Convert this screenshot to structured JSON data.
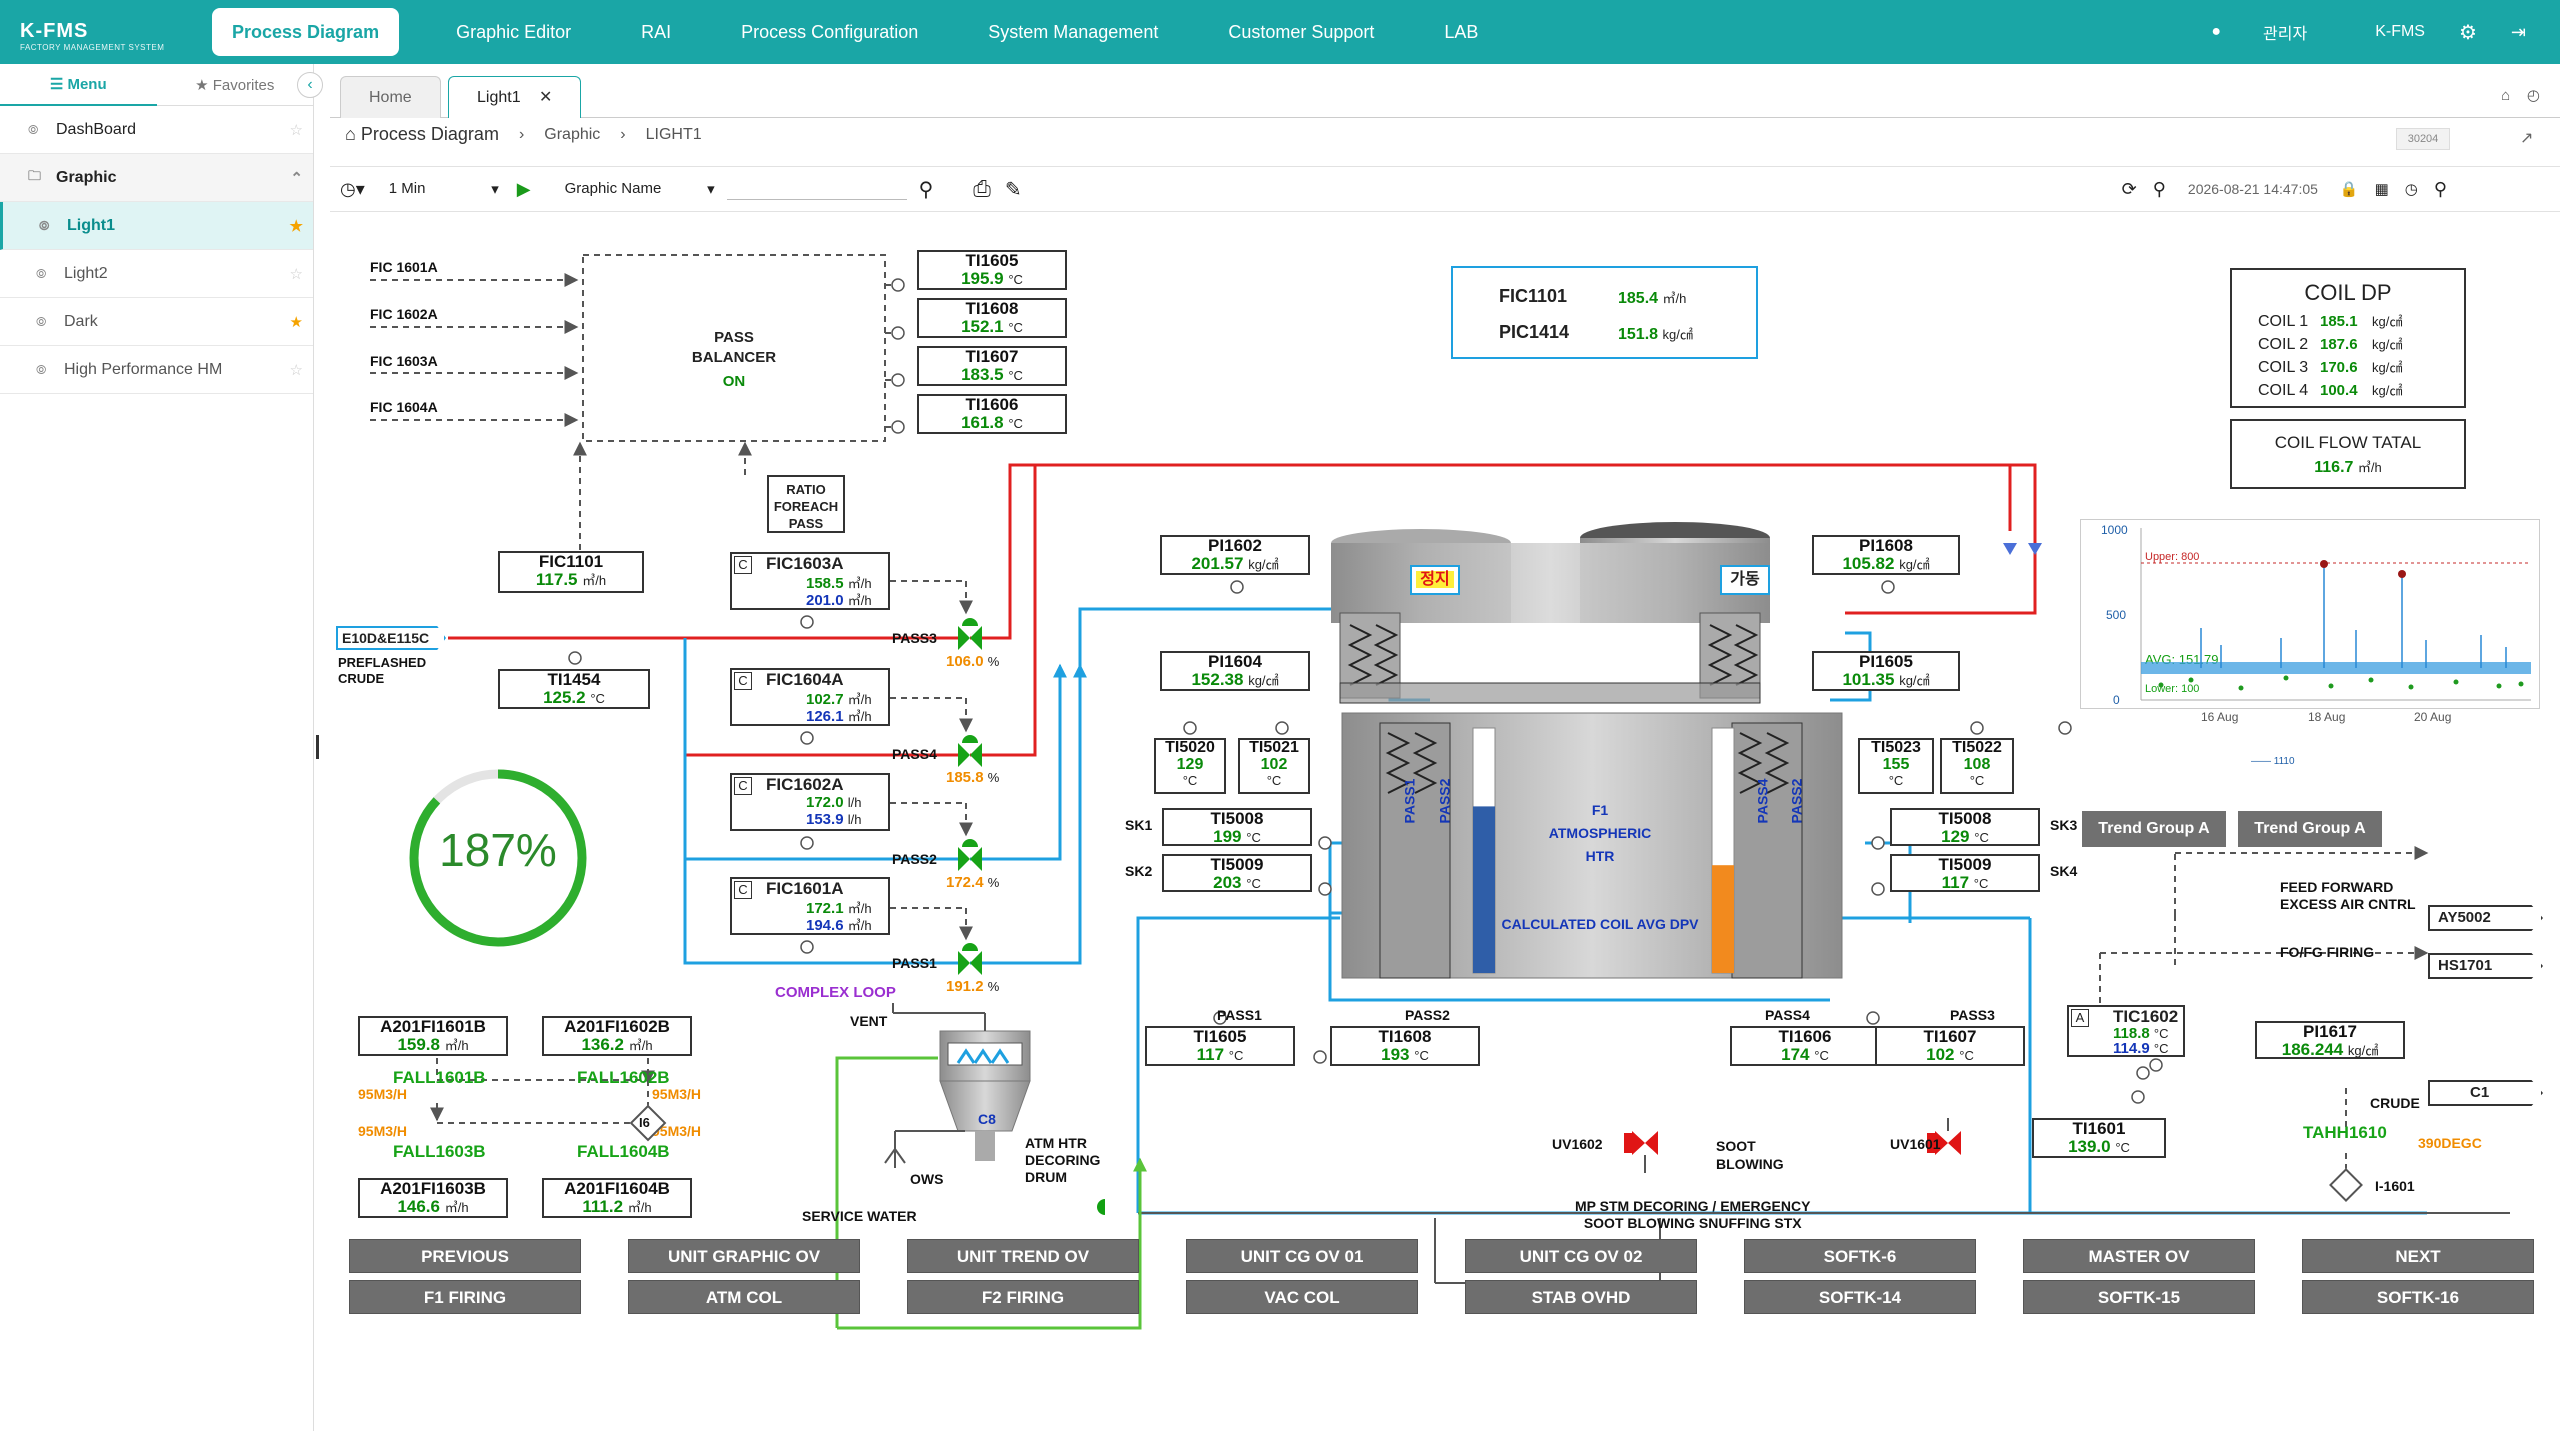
{
  "app": {
    "logo": "K-FMS",
    "logo_sub": "FACTORY MANAGEMENT SYSTEM"
  },
  "menu": [
    "Process Diagram",
    "Graphic Editor",
    "RAI",
    "Process Configuration",
    "System Management",
    "Customer Support",
    "LAB"
  ],
  "user": {
    "name": "관리자",
    "site": "K-FMS"
  },
  "sidebar": {
    "tab_menu": "Menu",
    "tab_favorites": "Favorites",
    "items": [
      {
        "label": "DashBoard",
        "star": false
      },
      {
        "label": "Graphic",
        "group": true
      },
      {
        "label": "Light1",
        "star": true,
        "selected": true
      },
      {
        "label": "Light2",
        "star": false
      },
      {
        "label": "Dark",
        "star": true
      },
      {
        "label": "High Performance HM",
        "star": false
      }
    ]
  },
  "tabs": {
    "home": "Home",
    "active": "Light1"
  },
  "breadcrumb": {
    "root": "Process Diagram",
    "mid": "Graphic",
    "leaf": "LIGHT1",
    "code": "30204"
  },
  "toolbar": {
    "interval": "1 Min",
    "graphic_name": "Graphic Name",
    "timestamp": "2026-08-21 14:47:05"
  },
  "diagram": {
    "fic_inputs": [
      "FIC 1601A",
      "FIC 1602A",
      "FIC 1603A",
      "FIC 1604A"
    ],
    "pass_balancer": {
      "l1": "PASS",
      "l2": "BALANCER",
      "state": "ON"
    },
    "ratio_box": [
      "RATIO",
      "FOREACH",
      "PASS"
    ],
    "ti_top": [
      {
        "tag": "TI1605",
        "val": "195.9",
        "unit": "°C"
      },
      {
        "tag": "TI1608",
        "val": "152.1",
        "unit": "°C"
      },
      {
        "tag": "TI1607",
        "val": "183.5",
        "unit": "°C"
      },
      {
        "tag": "TI1606",
        "val": "161.8",
        "unit": "°C"
      }
    ],
    "fic1101_left": {
      "tag": "FIC1101",
      "val": "117.5",
      "unit": "㎥/h"
    },
    "ti1454": {
      "tag": "TI1454",
      "val": "125.2",
      "unit": "°C"
    },
    "feed": {
      "tag": "E10D&E115C",
      "l1": "PRELASHED",
      "l2": "CRUDE"
    },
    "feed_l1": "PREFLASHED",
    "gauge_value": "187%",
    "gauge_fraction": 0.87,
    "fic_pass": [
      {
        "tag": "FIC1603A",
        "v1": "158.5",
        "v2": "201.0",
        "unit": "㎥/h",
        "pass": "PASS3",
        "pct": "106.0",
        "c": "C"
      },
      {
        "tag": "FIC1604A",
        "v1": "102.7",
        "v2": "126.1",
        "unit": "㎥/h",
        "pass": "PASS4",
        "pct": "185.8",
        "c": "C"
      },
      {
        "tag": "FIC1602A",
        "v1": "172.0",
        "v2": "153.9",
        "unit": "l/h",
        "pass": "PASS2",
        "pct": "172.4",
        "c": "C"
      },
      {
        "tag": "FIC1601A",
        "v1": "172.1",
        "v2": "194.6",
        "unit": "㎥/h",
        "pass": "PASS1",
        "pct": "191.2",
        "c": "C"
      }
    ],
    "pct_unit": "%",
    "complex_loop": "COMPLEX LOOP",
    "fic_summary": [
      {
        "tag": "FIC1101",
        "val": "185.4",
        "unit": "㎥/h"
      },
      {
        "tag": "PIC1414",
        "val": "151.8",
        "unit": "kg/㎠"
      }
    ],
    "coil_dp": {
      "title": "COIL DP",
      "rows": [
        {
          "tag": "COIL 1",
          "val": "185.1",
          "unit": "kg/㎠"
        },
        {
          "tag": "COIL 2",
          "val": "187.6",
          "unit": "kg/㎠"
        },
        {
          "tag": "COIL 3",
          "val": "170.6",
          "unit": "kg/㎠"
        },
        {
          "tag": "COIL 4",
          "val": "100.4",
          "unit": "kg/㎠"
        }
      ]
    },
    "coil_flow": {
      "title": "COIL FLOW TATAL",
      "val": "116.7",
      "unit": "㎥/h"
    },
    "pi_left": [
      {
        "tag": "PI1602",
        "val": "201.57",
        "unit": "kg/㎠"
      },
      {
        "tag": "PI1604",
        "val": "152.38",
        "unit": "kg/㎠"
      }
    ],
    "pi_right": [
      {
        "tag": "PI1608",
        "val": "105.82",
        "unit": "kg/㎠"
      },
      {
        "tag": "PI1605",
        "val": "101.35",
        "unit": "kg/㎠"
      }
    ],
    "stop_label": "정지",
    "run_label": "가동",
    "ti_small_left": [
      {
        "tag": "TI5020",
        "val": "129",
        "unit": "°C"
      },
      {
        "tag": "TI5021",
        "val": "102",
        "unit": "°C"
      }
    ],
    "ti_small_right": [
      {
        "tag": "TI5023",
        "val": "155",
        "unit": "°C"
      },
      {
        "tag": "TI5022",
        "val": "108",
        "unit": "°C"
      }
    ],
    "sk_left": [
      {
        "sk": "SK1",
        "tag": "TI5008",
        "val": "199",
        "unit": "°C"
      },
      {
        "sk": "SK2",
        "tag": "TI5009",
        "val": "203",
        "unit": "°C"
      }
    ],
    "sk_right": [
      {
        "sk": "SK3",
        "tag": "TI5008",
        "val": "129",
        "unit": "°C"
      },
      {
        "sk": "SK4",
        "tag": "TI5009",
        "val": "117",
        "unit": "°C"
      }
    ],
    "furnace": {
      "l1": "F1",
      "l2": "ATMOSPHERIC",
      "l3": "HTR",
      "l4": "CALCULATED COIL AVG DPV",
      "level_left": 0.68,
      "level_right": 0.44
    },
    "pass_labels": [
      "PASS1",
      "PASS2",
      "PASS4",
      "PASS2"
    ],
    "ti_bottom": [
      {
        "pass": "PASS1",
        "tag": "TI1605",
        "val": "117",
        "unit": "°C"
      },
      {
        "pass": "PASS2",
        "tag": "TI1608",
        "val": "193",
        "unit": "°C"
      },
      {
        "pass": "PASS4",
        "tag": "TI1606",
        "val": "174",
        "unit": "°C"
      },
      {
        "pass": "PASS3",
        "tag": "TI1607",
        "val": "102",
        "unit": "°C"
      }
    ],
    "tic1602": {
      "c": "A",
      "tag": "TIC1602",
      "v1": "118.8",
      "v2": "114.9",
      "unit": "°C"
    },
    "pi1617": {
      "tag": "PI1617",
      "val": "186.244",
      "unit": "kg/㎠"
    },
    "ti1601": {
      "tag": "TI1601",
      "val": "139.0",
      "unit": "°C"
    },
    "right_tags": [
      {
        "label": "FEED FORWARD",
        "label2": "EXCESS AIR CNTRL",
        "tag": "AY5002"
      },
      {
        "label": "FO/FG FIRING",
        "tag": "HS1701"
      },
      {
        "label": "CRUDE",
        "tag": "C1"
      }
    ],
    "tahh": {
      "tag": "TAHH1610",
      "val": "390DEGC"
    },
    "i1601": "I-1601",
    "uv": [
      "UV1602",
      "UV1601"
    ],
    "soot": {
      "l1": "SOOT",
      "l2": "BLOWING",
      "l3": "MP STM DECORING / EMERGENCY",
      "l4": "SOOT BLOWING SNUFFING STX"
    },
    "vent": "VENT",
    "c8": {
      "tag": "C8",
      "l1": "ATM HTR",
      "l2": "DECORING",
      "l3": "DRUM"
    },
    "ows": "OWS",
    "service_water": "SERVICE WATER",
    "fall_boxes": [
      {
        "tag": "A201FI1601B",
        "val": "159.8",
        "unit": "㎥/h",
        "fall": "FALL1601B",
        "rate": "95M3/H"
      },
      {
        "tag": "A201FI1602B",
        "val": "136.2",
        "unit": "㎥/h",
        "fall": "FALL1602B",
        "rate": "95M3/H"
      },
      {
        "tag": "A201FI1603B",
        "val": "146.6",
        "unit": "㎥/h",
        "fall": "FALL1603B",
        "rate": "95M3/H"
      },
      {
        "tag": "A201FI1604B",
        "val": "111.2",
        "unit": "㎥/h",
        "fall": "FALL1604B",
        "rate": "95M3/H"
      }
    ],
    "i16": "I6"
  },
  "trend": {
    "ymax": "1000",
    "ymid": "500",
    "ymin": "0",
    "upper_label": "Upper: 800",
    "avg_label": "AVG: 151.79",
    "lower_label": "Lower: 100",
    "x_labels": [
      "16 Aug",
      "18 Aug",
      "20 Aug"
    ],
    "legend": "1110",
    "buttons": [
      "Trend Group A",
      "Trend Group A"
    ]
  },
  "bottom_buttons": [
    [
      "PREVIOUS",
      "UNIT GRAPHIC OV",
      "UNIT TREND OV",
      "UNIT CG OV 01",
      "UNIT CG OV 02",
      "SOFTK-6",
      "MASTER OV",
      "NEXT"
    ],
    [
      "F1 FIRING",
      "ATM COL",
      "F2 FIRING",
      "VAC COL",
      "STAB OVHD",
      "SOFTK-14",
      "SOFTK-15",
      "SOFTK-16"
    ]
  ],
  "colors": {
    "accent": "#1aa6a6",
    "line_red": "#e02020",
    "line_blue": "#1ea0e0",
    "value_green": "#0a8a0a",
    "value_blue": "#1436b8",
    "value_orange": "#f08c00"
  }
}
